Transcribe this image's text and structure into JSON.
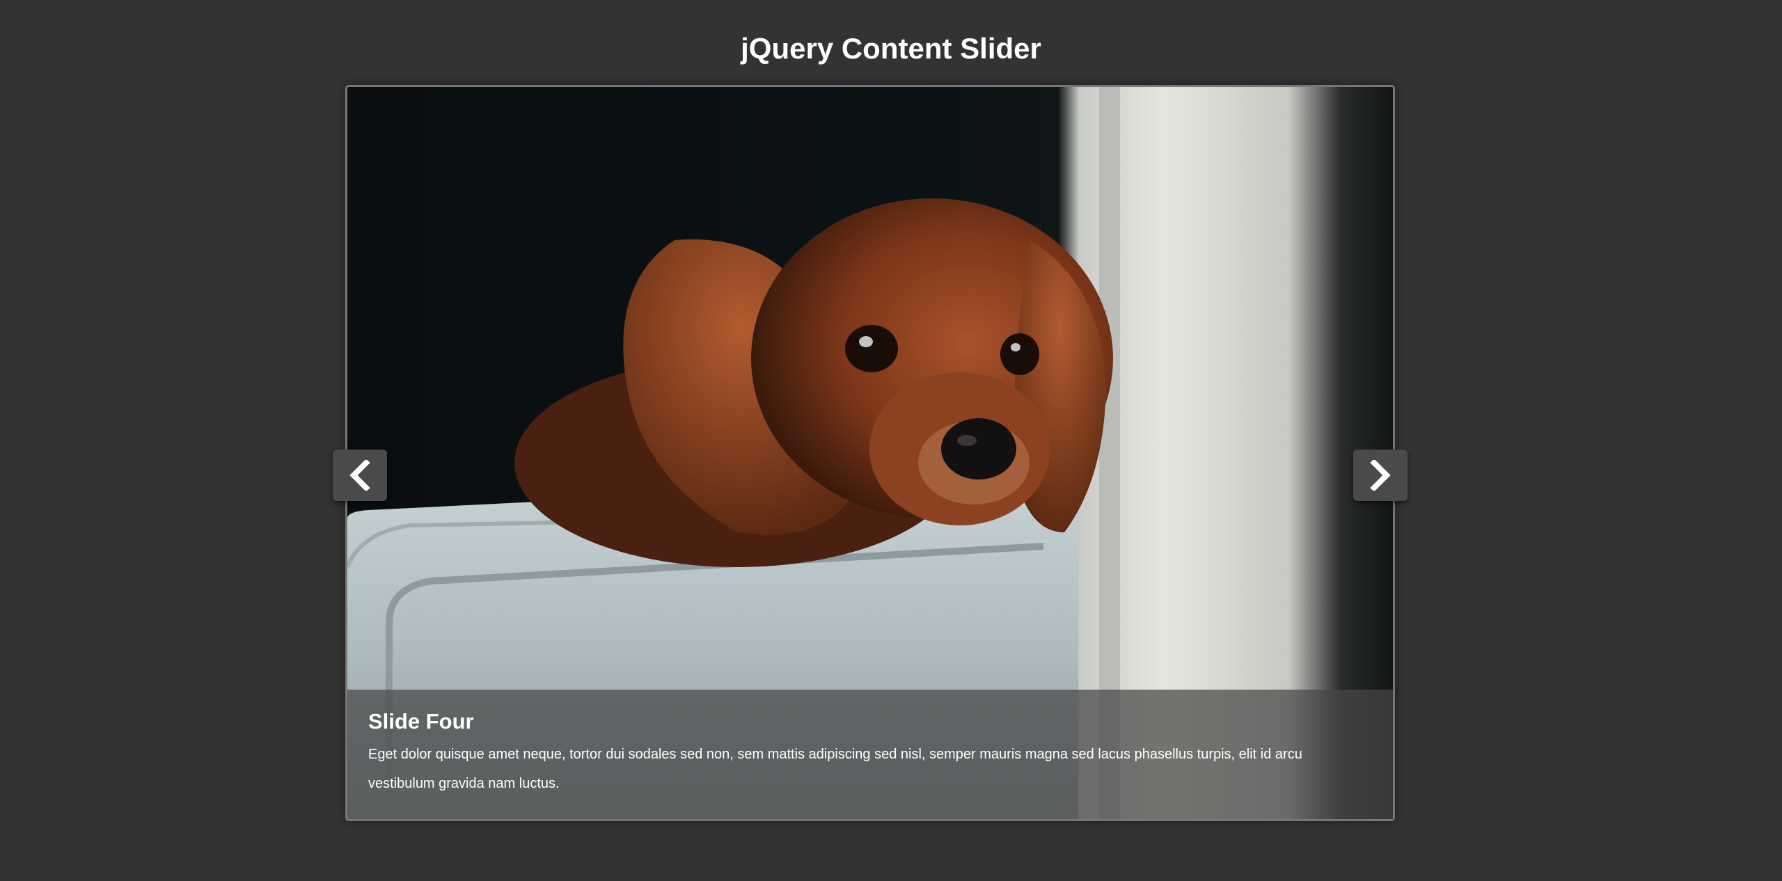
{
  "page": {
    "title": "jQuery Content Slider",
    "background": "#333333"
  },
  "slider": {
    "current_slide": {
      "title": "Slide Four",
      "text": "Eget dolor quisque amet neque, tortor dui sodales sed non, sem mattis adipiscing sed nisl, semper mauris magna sed lacus phasellus turpis, elit id arcu vestibulum gravida nam luctus.",
      "image_subject": "puppy-on-sofa-photo"
    },
    "controls": {
      "prev_icon": "chevron-left-icon",
      "next_icon": "chevron-right-icon"
    }
  }
}
